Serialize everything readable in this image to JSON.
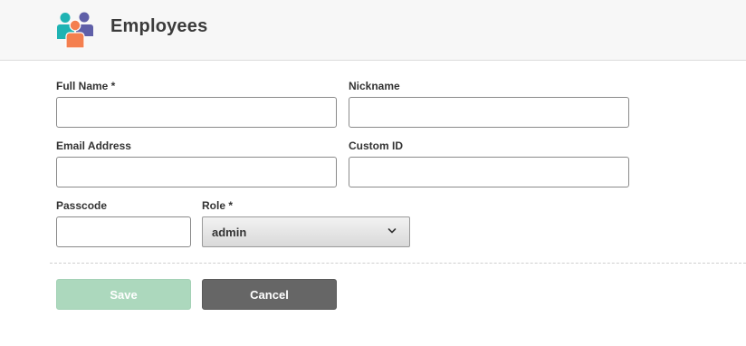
{
  "header": {
    "title": "Employees",
    "logo_icon": "employees-people-icon"
  },
  "form": {
    "full_name": {
      "label": "Full Name *",
      "value": "",
      "placeholder": ""
    },
    "nickname": {
      "label": "Nickname",
      "value": "",
      "placeholder": ""
    },
    "email": {
      "label": "Email Address",
      "value": "",
      "placeholder": ""
    },
    "custom_id": {
      "label": "Custom ID",
      "value": "",
      "placeholder": ""
    },
    "passcode": {
      "label": "Passcode",
      "value": "",
      "placeholder": ""
    },
    "role": {
      "label": "Role *",
      "selected": "admin",
      "icon": "chevron-down-icon"
    }
  },
  "actions": {
    "save_label": "Save",
    "cancel_label": "Cancel"
  },
  "colors": {
    "save_bg": "#acd8bd",
    "cancel_bg": "#666666",
    "logo_teal": "#1fb3b3",
    "logo_orange": "#f47f4f",
    "logo_purple": "#5f5fa8"
  }
}
